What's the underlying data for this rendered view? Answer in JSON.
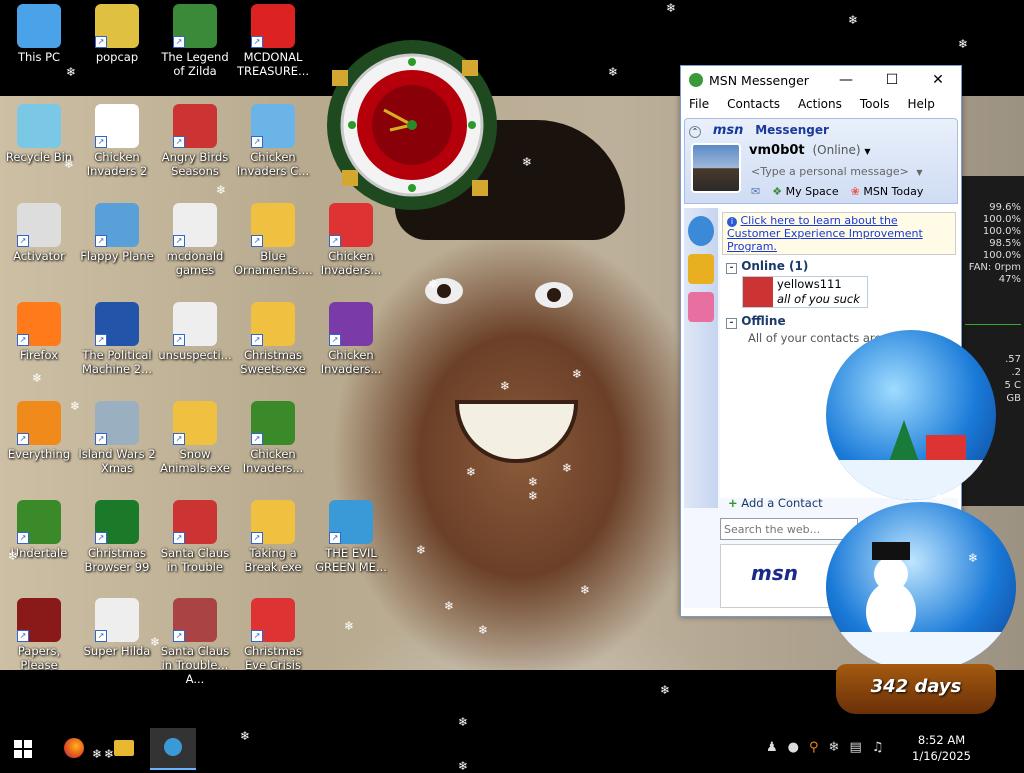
{
  "desktop": {
    "icons": [
      {
        "label": "This PC",
        "color": "#4aa3e8"
      },
      {
        "label": "popcap",
        "color": "#e0c040"
      },
      {
        "label": "The Legend of Zilda",
        "color": "#3a8a3a"
      },
      {
        "label": "MCDONAL TREASURE...",
        "color": "#d22"
      },
      {
        "label": "Recycle Bin",
        "color": "#7ac7e6"
      },
      {
        "label": "Chicken Invaders 2",
        "color": "#ffffff"
      },
      {
        "label": "Angry Birds Seasons",
        "color": "#c33"
      },
      {
        "label": "Chicken Invaders C...",
        "color": "#6ab4e8"
      },
      {
        "label": "Activator",
        "color": "#dddddd"
      },
      {
        "label": "Flappy Plane",
        "color": "#5aa0d8"
      },
      {
        "label": "mcdonald games",
        "color": "#eeeeee"
      },
      {
        "label": "Blue Ornaments....",
        "color": "#f0c040"
      },
      {
        "label": "Chicken Invaders...",
        "color": "#d33"
      },
      {
        "label": "Firefox",
        "color": "#ff7a1a"
      },
      {
        "label": "The Political Machine 2...",
        "color": "#2255aa"
      },
      {
        "label": "unsuspecti...",
        "color": "#eeeeee"
      },
      {
        "label": "Christmas Sweets.exe",
        "color": "#f0c040"
      },
      {
        "label": "Chicken Invaders...",
        "color": "#7a3aa8"
      },
      {
        "label": "Everything",
        "color": "#f08a1a"
      },
      {
        "label": "Island Wars 2 Xmas",
        "color": "#9ab0c0"
      },
      {
        "label": "Snow Animals.exe",
        "color": "#f0c040"
      },
      {
        "label": "Chicken Invaders...",
        "color": "#3a8a2a"
      },
      {
        "label": "Undertale",
        "color": "#3a8a2a"
      },
      {
        "label": "Christmas Browser 99",
        "color": "#1a7a2a"
      },
      {
        "label": "Santa Claus in Trouble",
        "color": "#c33"
      },
      {
        "label": "Taking a Break.exe",
        "color": "#f0c040"
      },
      {
        "label": "THE EVIL GREEN ME...",
        "color": "#3a9ad8"
      },
      {
        "label": "Papers, Please",
        "color": "#8a1a1a"
      },
      {
        "label": "Super Hilda",
        "color": "#eeeeee"
      },
      {
        "label": "Santa Claus in Trouble... A...",
        "color": "#a44"
      },
      {
        "label": "Christmas Eve Crisis",
        "color": "#d33"
      }
    ]
  },
  "msn": {
    "title": "MSN Messenger",
    "menu": [
      "File",
      "Contacts",
      "Actions",
      "Tools",
      "Help"
    ],
    "brand": "msn",
    "brand_product": "Messenger",
    "username": "vm0b0t",
    "status": "(Online)",
    "personal_message_placeholder": "<Type a personal message>",
    "my_space": "My Space",
    "msn_today": "MSN Today",
    "ceip_link": "Click here to learn about the Customer Experience Improvement Program.",
    "group_online": "Online (1)",
    "contact_name": "yellows111",
    "contact_message": "all of you suck",
    "group_offline": "Offline",
    "offline_note": "All of your contacts are online or...",
    "add_contact": "Add a Contact",
    "search_placeholder": "Search the web...",
    "ad_brand": "msn"
  },
  "gadget": {
    "lines": [
      "99.6%",
      "100.0%",
      "100.0%",
      "98.5%",
      "100.0%",
      "FAN: 0rpm",
      "47%"
    ],
    "lower": [
      ".57",
      ".2",
      "5 C",
      "GB"
    ]
  },
  "globe_counter": "342 days",
  "taskbar": {
    "time": "8:52 AM",
    "date": "1/16/2025"
  }
}
